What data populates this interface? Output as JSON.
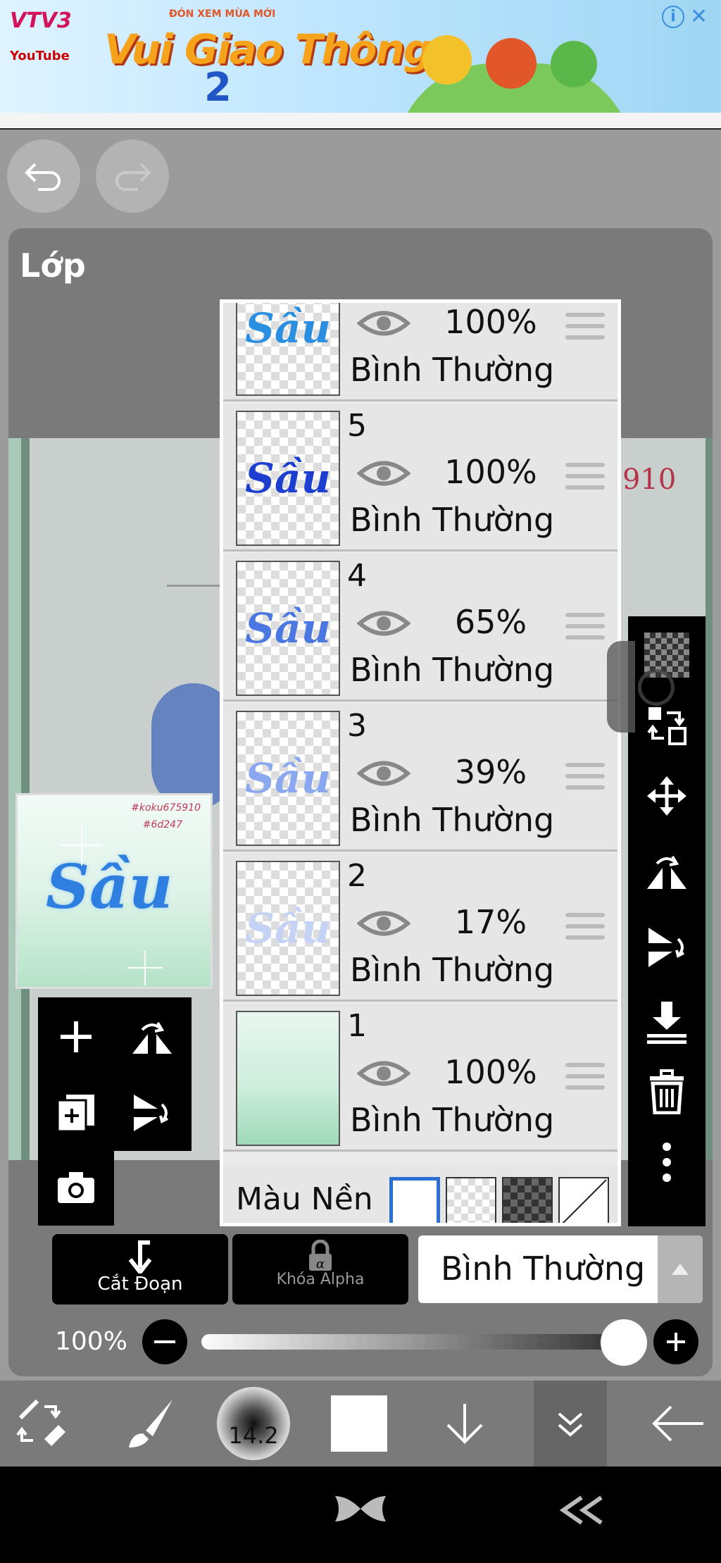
{
  "ad": {
    "channel": "VTV3",
    "channel_sub": "YouTube",
    "promo": "ĐÓN XEM MÙA MỚI",
    "show_title": "Vui Giao Thông",
    "season": "2",
    "badge": "i"
  },
  "panel": {
    "title": "Lớp"
  },
  "layers": [
    {
      "number": "",
      "opacity": "100%",
      "blend": "Bình Thường",
      "thumb_text": "Sầu",
      "thumb_color": "#2a8fe0"
    },
    {
      "number": "5",
      "opacity": "100%",
      "blend": "Bình Thường",
      "thumb_text": "Sầu",
      "thumb_color": "#1c3fd0"
    },
    {
      "number": "4",
      "opacity": "65%",
      "blend": "Bình Thường",
      "thumb_text": "Sầu",
      "thumb_color": "#4a78e0"
    },
    {
      "number": "3",
      "opacity": "39%",
      "blend": "Bình Thường",
      "thumb_text": "Sầu",
      "thumb_color": "#8aa8f0"
    },
    {
      "number": "2",
      "opacity": "17%",
      "blend": "Bình Thường",
      "thumb_text": "Sầu",
      "thumb_color": "#c4d2f6"
    },
    {
      "number": "1",
      "opacity": "100%",
      "blend": "Bình Thường",
      "thumb_text": "",
      "thumb_color": "#9fd9b9"
    }
  ],
  "background": {
    "label": "Màu Nền",
    "selected_index": 0
  },
  "preview": {
    "title": "Sầu",
    "line1": "#koku675910",
    "line2": "#6d247"
  },
  "canvas_text": "910",
  "controls": {
    "clip_label": "Cắt Đoạn",
    "alpha_lock_label": "Khóa Alpha",
    "blend_mode": "Bình Thường",
    "opacity_label": "100%",
    "opacity_value": 1.0
  },
  "toolbar": {
    "brush_size": "14.2"
  },
  "colors": {
    "accent": "#2a6fd6",
    "panel": "#7a7a7a",
    "toolbar": "#000000"
  }
}
